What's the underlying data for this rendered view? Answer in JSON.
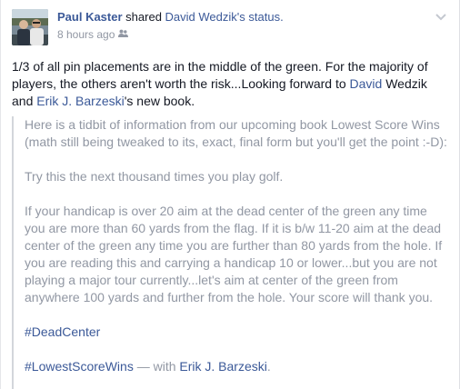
{
  "header": {
    "author": "Paul Kaster",
    "verb": "shared",
    "status_owner": "David Wedzik's",
    "status_word": "status.",
    "timestamp": "8 hours ago",
    "privacy_icon": "friends-icon",
    "menu_icon": "chevron-down-icon"
  },
  "message": {
    "text_1": "1/3 of all pin placements are in the middle of the green. For the majority of players, the others aren't worth the risk...Looking forward to ",
    "link_david": "David",
    "text_2": " Wedzik and ",
    "link_erik": "Erik J. Barzeski",
    "text_3": "'s new book."
  },
  "shared_post": {
    "paragraph_1": "Here is a tidbit of information from our upcoming book Lowest Score Wins (math still being tweaked to its, exact, final form but you'll get the point :-D):",
    "paragraph_2": "Try this the next thousand times you play golf.",
    "paragraph_3": "If your handicap is over 20 aim at the dead center of the green any time you are more than 60 yards from the flag. If it is b/w 11-20 aim at the dead center of the green any time you are further than 80 yards from the hole. If you are reading this and carrying a handicap 10 or lower...but you are not playing a major tour currently...let's aim at center of the green from anywhere 100 yards and further from the hole. Your score will thank you.",
    "hashtag_1": "#DeadCenter",
    "hashtag_2": "#LowestScoreWins",
    "with_text": " — with ",
    "tagged_person": "Erik J. Barzeski",
    "period": "."
  },
  "colors": {
    "link": "#3b5998",
    "text": "#141823",
    "muted": "#9197a3"
  }
}
